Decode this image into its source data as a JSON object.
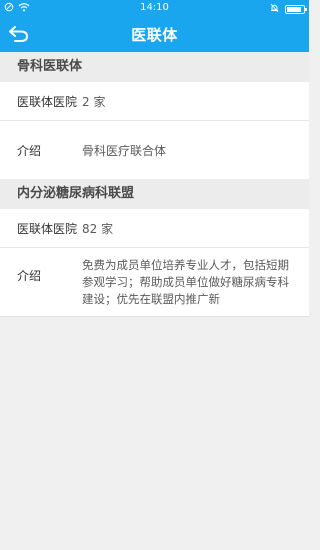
{
  "status_bar": {
    "time": "14:10",
    "battery_level": 0.85,
    "left_icons": [
      "sync-icon",
      "wifi-icon"
    ],
    "right_icons": [
      "alarm-icon",
      "battery-icon"
    ]
  },
  "navbar": {
    "title": "医联体",
    "back_icon": "back-arrow-icon",
    "color": "#1aa5ef"
  },
  "sections": [
    {
      "title": "骨科医联体",
      "rows": [
        {
          "label": "医联体医院",
          "value": "2 家"
        },
        {
          "label": "介绍",
          "value": "骨科医疗联合体"
        }
      ]
    },
    {
      "title": "内分泌糖尿病科联盟",
      "rows": [
        {
          "label": "医联体医院",
          "value": "82 家"
        },
        {
          "label": "介绍",
          "value": "免费为成员单位培养专业人才，包括短期参观学习；帮助成员单位做好糖尿病专科建设；优先在联盟内推广新"
        }
      ]
    }
  ]
}
